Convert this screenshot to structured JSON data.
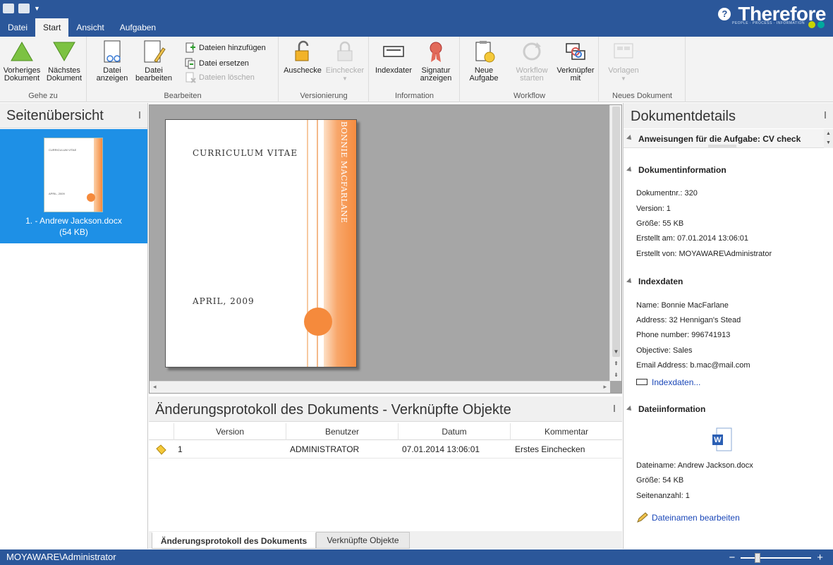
{
  "window": {
    "brand": "Therefore",
    "tagline": "PEOPLE · PROCESS · INFORMATION",
    "help_icon": "question-icon",
    "colors": {
      "accent": "#2b579a",
      "selection": "#1e90e6",
      "orange": "#f58a3c",
      "brand_green": "#c8d400",
      "brand_teal": "#00a99d"
    }
  },
  "ribbon_tabs": [
    {
      "label": "Datei"
    },
    {
      "label": "Start"
    },
    {
      "label": "Ansicht"
    },
    {
      "label": "Aufgaben"
    }
  ],
  "ribbon": {
    "goto": {
      "label": "Gehe zu",
      "prev": "Vorheriges Dokument",
      "next": "Nächstes Dokument"
    },
    "edit": {
      "label": "Bearbeiten",
      "view_file": "Datei anzeigen",
      "edit_file": "Datei bearbeiten",
      "add_files": "Dateien hinzufügen",
      "replace_file": "Datei ersetzen",
      "delete_files": "Dateien löschen"
    },
    "versioning": {
      "label": "Versionierung",
      "checkout": "Auschecke",
      "checkin": "Einchecker"
    },
    "information": {
      "label": "Information",
      "indexdata": "Indexdater",
      "signature": "Signatur anzeigen"
    },
    "workflow": {
      "label": "Workflow",
      "new_task": "Neue Aufgabe",
      "start_workflow": "Workflow starten",
      "link_with": "Verknüpfer mit"
    },
    "new_document": {
      "label": "Neues Dokument",
      "templates": "Vorlagen"
    }
  },
  "left_pane": {
    "title": "Seitenübersicht",
    "thumbnail": {
      "name": "1. - Andrew Jackson.docx",
      "size": "(54 KB)"
    }
  },
  "document_preview": {
    "title": "CURRICULUM VITAE",
    "date": "APRIL, 2009",
    "name": "BONNIE MACFARLANE"
  },
  "history": {
    "title": "Änderungsprotokoll des Dokuments - Verknüpfte Objekte",
    "columns": [
      "Version",
      "Benutzer",
      "Datum",
      "Kommentar"
    ],
    "rows": [
      {
        "version": "1",
        "user": "ADMINISTRATOR",
        "date": "07.01.2014 13:06:01",
        "comment": "Erstes Einchecken"
      }
    ],
    "tabs": [
      "Änderungsprotokoll des Dokuments",
      "Verknüpfte Objekte"
    ]
  },
  "details": {
    "title": "Dokumentdetails",
    "task_section": "Anweisungen für die Aufgabe: CV check",
    "doc_info": {
      "header": "Dokumentinformation",
      "number": "Dokumentnr.: 320",
      "version": "Version: 1",
      "size": "Größe: 55 KB",
      "created_at": "Erstellt am: 07.01.2014 13:06:01",
      "created_by": "Erstellt von: MOYAWARE\\Administrator"
    },
    "index": {
      "header": "Indexdaten",
      "name": "Name: Bonnie MacFarlane",
      "address": "Address: 32 Hennigan's Stead",
      "phone": "Phone number: 996741913",
      "objective": "Objective: Sales",
      "email": "Email Address: b.mac@mail.com",
      "link": "Indexdaten..."
    },
    "file_info": {
      "header": "Dateiinformation",
      "filename": "Dateiname: Andrew Jackson.docx",
      "size": "Größe: 54 KB",
      "pages": "Seitenanzahl: 1",
      "edit_link": "Dateinamen bearbeiten"
    }
  },
  "status": {
    "user": "MOYAWARE\\Administrator",
    "zoom_out": "−",
    "zoom_in": "+"
  }
}
